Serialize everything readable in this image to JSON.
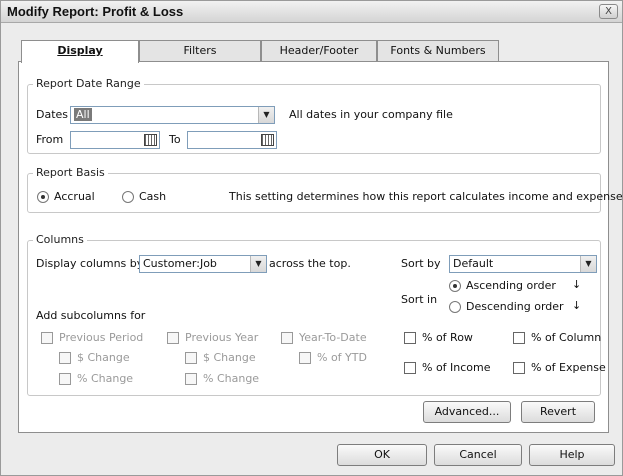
{
  "window": {
    "title": "Modify Report: Profit & Loss",
    "close_label": "X"
  },
  "tabs": [
    {
      "label": "Display",
      "active": true
    },
    {
      "label": "Filters",
      "active": false
    },
    {
      "label": "Header/Footer",
      "active": false
    },
    {
      "label": "Fonts & Numbers",
      "active": false
    }
  ],
  "date_range": {
    "group_label": "Report Date Range",
    "dates_label": "Dates",
    "dates_value": "All",
    "dates_description": "All dates in your company file",
    "from_label": "From",
    "from_value": "",
    "to_label": "To",
    "to_value": ""
  },
  "basis": {
    "group_label": "Report Basis",
    "accrual_label": "Accrual",
    "cash_label": "Cash",
    "selected": "accrual",
    "description": "This setting determines how this report calculates income and expenses."
  },
  "columns": {
    "group_label": "Columns",
    "display_by_label": "Display columns by",
    "display_by_value": "Customer:Job",
    "across_label": "across the top.",
    "sort_by_label": "Sort by",
    "sort_by_value": "Default",
    "sort_in_label": "Sort in",
    "ascending_label": "Ascending order",
    "descending_label": "Descending order",
    "sort_selected": "ascending",
    "subcolumns_label": "Add subcolumns for",
    "previous_period": "Previous Period",
    "previous_year": "Previous Year",
    "year_to_date": "Year-To-Date",
    "dollar_change_1": "$ Change",
    "pct_change_1": "% Change",
    "dollar_change_2": "$ Change",
    "pct_change_2": "% Change",
    "pct_ytd": "% of YTD",
    "pct_row": "% of Row",
    "pct_column": "% of Column",
    "pct_income": "% of Income",
    "pct_expense": "% of Expense"
  },
  "panel_buttons": {
    "advanced": "Advanced...",
    "revert": "Revert"
  },
  "footer_buttons": {
    "ok": "OK",
    "cancel": "Cancel",
    "help": "Help"
  }
}
